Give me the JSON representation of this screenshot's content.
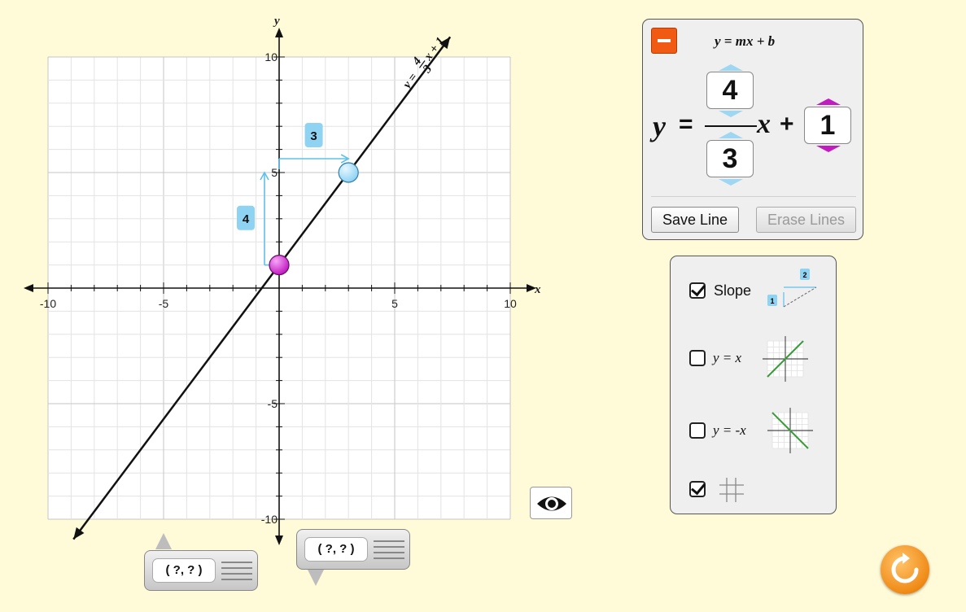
{
  "graph": {
    "x_axis": {
      "name": "x",
      "min": -10,
      "max": 10,
      "tick_labels": [
        -10,
        -5,
        5,
        10
      ]
    },
    "y_axis": {
      "name": "y",
      "min": -10,
      "max": 10,
      "tick_labels": [
        10,
        5,
        -5,
        -10
      ]
    },
    "line": {
      "slope_num": 4,
      "slope_den": 3,
      "intercept": 1
    },
    "line_label": {
      "lhs": "y =",
      "num": "4",
      "den": "3",
      "rest": "x + 1"
    },
    "intercept_point": {
      "x": 0,
      "y": 1,
      "color": "#c21bc2"
    },
    "slope_point": {
      "x": 3,
      "y": 5,
      "color": "#8fd3f3"
    },
    "rise_label": "4",
    "run_label": "3",
    "grid_visible": true,
    "slope_visible": true
  },
  "equation_panel": {
    "header": "y = mx + b",
    "y_symbol": "y",
    "equals": "=",
    "numerator": "4",
    "denominator": "3",
    "x_symbol": "x",
    "plus": "+",
    "intercept": "1",
    "save_label": "Save Line",
    "erase_label": "Erase Lines"
  },
  "options_panel": {
    "slope": {
      "label": "Slope",
      "checked": true,
      "thumb_rise": "1",
      "thumb_run": "2"
    },
    "y_eq_x": {
      "label": "y = x",
      "checked": false
    },
    "y_eq_neg_x": {
      "label": "y = -x",
      "checked": false
    },
    "grid": {
      "checked": true
    }
  },
  "coord_readouts": [
    {
      "value": "( ?, ? )"
    },
    {
      "value": "( ?, ? )"
    }
  ],
  "colors": {
    "background": "#fffbd8",
    "minus_button": "#f05a12",
    "reset_button": "#f08a16",
    "slope_arrows": "#5fc0ec",
    "label_bg": "#8fd3f3",
    "green_line": "#3a9b3a"
  }
}
